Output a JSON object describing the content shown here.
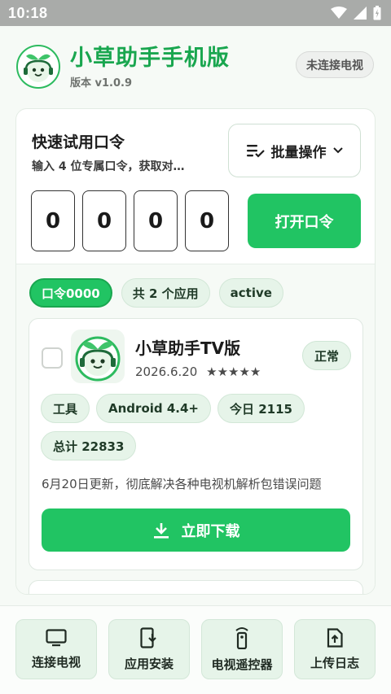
{
  "status_bar": {
    "time": "10:18"
  },
  "header": {
    "title": "小草助手手机版",
    "version": "版本 v1.0.9",
    "connection_status": "未连接电视"
  },
  "quick_code": {
    "title": "快速试用口令",
    "subtitle": "输入 4 位专属口令，获取对…",
    "batch_label": "批量操作",
    "digits": [
      "0",
      "0",
      "0",
      "0"
    ],
    "open_label": "打开口令"
  },
  "filters": {
    "active_code": "口令0000",
    "app_count": "共 2 个应用",
    "state": "active"
  },
  "apps": [
    {
      "name": "小草助手TV版",
      "date": "2026.6.20",
      "stars": "★★★★★",
      "rating": 5,
      "status": "正常",
      "tags": [
        "工具",
        "Android 4.4+",
        "今日 2115",
        "总计 22833"
      ],
      "description": "6月20日更新，彻底解决各种电视机解析包错误问题",
      "download_label": "立即下载",
      "checked": false
    }
  ],
  "bottom_nav": [
    {
      "label": "连接电视",
      "icon": "tv-icon"
    },
    {
      "label": "应用安装",
      "icon": "install-icon"
    },
    {
      "label": "电视遥控器",
      "icon": "remote-icon"
    },
    {
      "label": "上传日志",
      "icon": "upload-icon"
    }
  ],
  "colors": {
    "accent": "#21c463",
    "accent_dark": "#19a64f",
    "chip_bg": "#e6f4e9",
    "background": "#f6faf6"
  }
}
